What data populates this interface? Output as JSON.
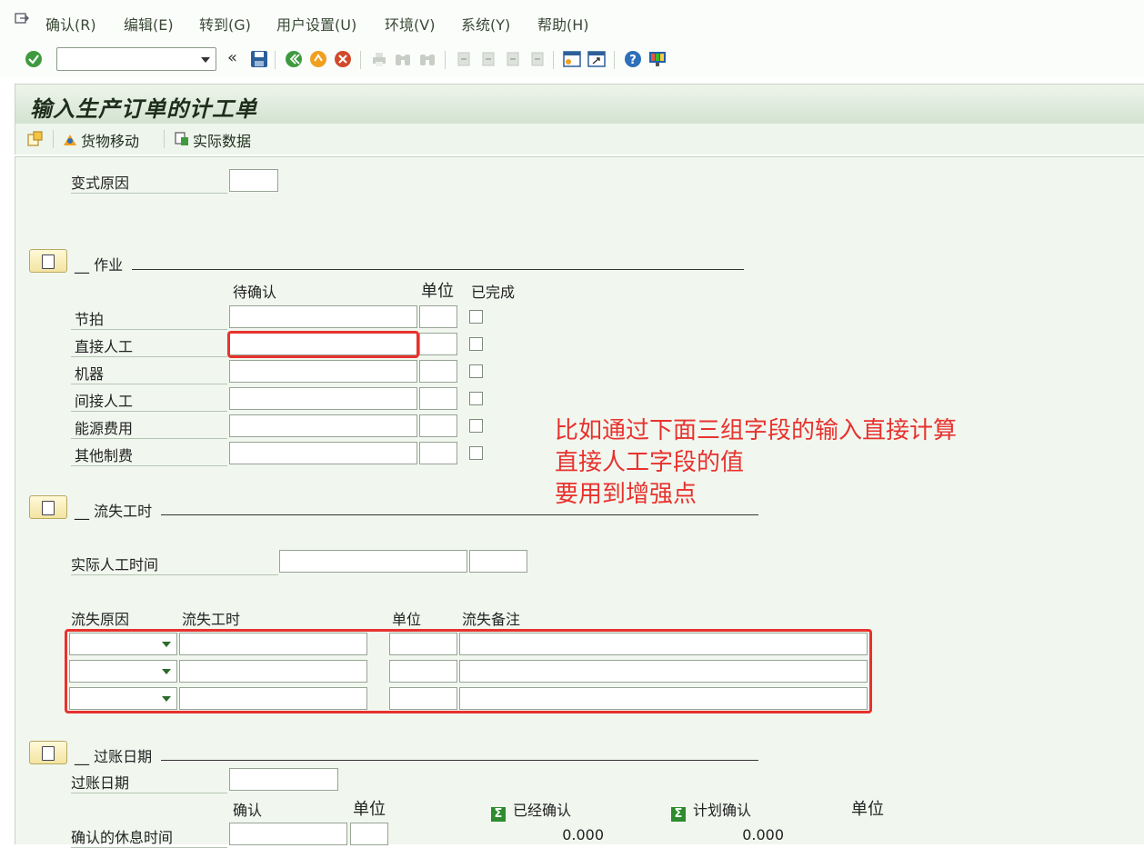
{
  "menu": [
    {
      "label": "确认(R)"
    },
    {
      "label": "编辑(E)"
    },
    {
      "label": "转到(G)"
    },
    {
      "label": "用户设置(U)"
    },
    {
      "label": "环境(V)"
    },
    {
      "label": "系统(Y)"
    },
    {
      "label": "帮助(H)"
    }
  ],
  "toolbar": {
    "command_field_value": "",
    "back_symbol": "«"
  },
  "title": "输入生产订单的计工单",
  "app_toolbar": {
    "goods_movement": "货物移动",
    "actual_data": "实际数据"
  },
  "variance": {
    "label": "变式原因",
    "value": ""
  },
  "activities": {
    "section_title": "__ 作业",
    "col_pending": "待确认",
    "col_unit": "单位",
    "col_done": "已完成",
    "rows": [
      {
        "label": "节拍"
      },
      {
        "label": "直接人工"
      },
      {
        "label": "机器"
      },
      {
        "label": "间接人工"
      },
      {
        "label": "能源费用"
      },
      {
        "label": "其他制费"
      }
    ]
  },
  "annotation": {
    "line1": "比如通过下面三组字段的输入直接计算",
    "line2": "直接人工字段的值",
    "line3": "要用到增强点",
    "color": "#e8322e"
  },
  "lost_time": {
    "section_title": "__ 流失工时",
    "actual_label": "实际人工时间",
    "col_reason": "流失原因",
    "col_hours": "流失工时",
    "col_unit": "单位",
    "col_note": "流失备注"
  },
  "posting": {
    "section_title": "__ 过账日期",
    "date_label": "过账日期",
    "col_confirm": "确认",
    "col_unit": "单位",
    "col_confirmed": "已经确认",
    "col_planned": "计划确认",
    "col_unit2": "单位",
    "break_label": "确认的休息时间",
    "confirmed_value": "0.000",
    "planned_value": "0.000"
  }
}
